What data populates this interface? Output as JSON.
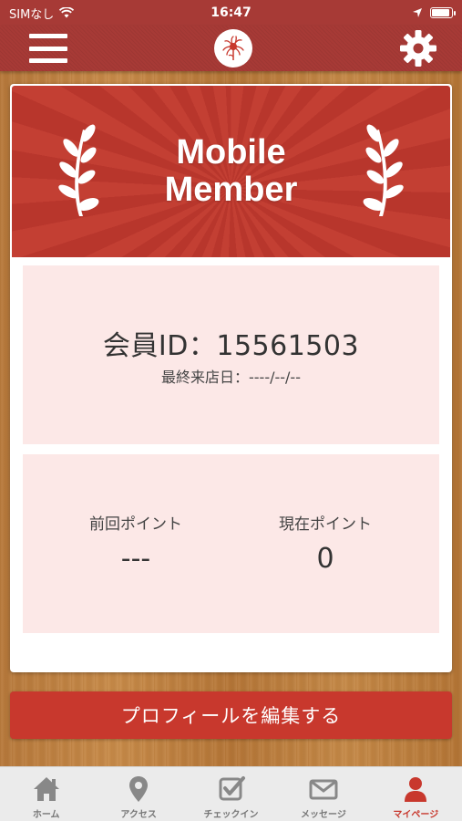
{
  "status_bar": {
    "carrier": "SIMなし",
    "time": "16:47"
  },
  "header": {
    "menu_icon": "hamburger-menu-icon",
    "logo_icon": "red-flower-logo",
    "settings_icon": "gear-icon"
  },
  "banner": {
    "title": "Mobile\nMember"
  },
  "member": {
    "id_text": "会員ID：15561503",
    "last_visit_text": "最終来店日：----/--/--"
  },
  "points": {
    "previous_label": "前回ポイント",
    "previous_value": "---",
    "current_label": "現在ポイント",
    "current_value": "0"
  },
  "edit_profile_label": "プロフィールを編集する",
  "tabs": [
    {
      "label": "ホーム",
      "icon": "home-icon"
    },
    {
      "label": "アクセス",
      "icon": "map-pin-icon"
    },
    {
      "label": "チェックイン",
      "icon": "checkin-icon"
    },
    {
      "label": "メッセージ",
      "icon": "envelope-icon"
    },
    {
      "label": "マイページ",
      "icon": "user-icon"
    }
  ],
  "colors": {
    "header": "#a73a36",
    "accent": "#c8382d",
    "panel": "#fce8e7",
    "active_tab": "#c8382d",
    "inactive_tab": "#888888"
  }
}
